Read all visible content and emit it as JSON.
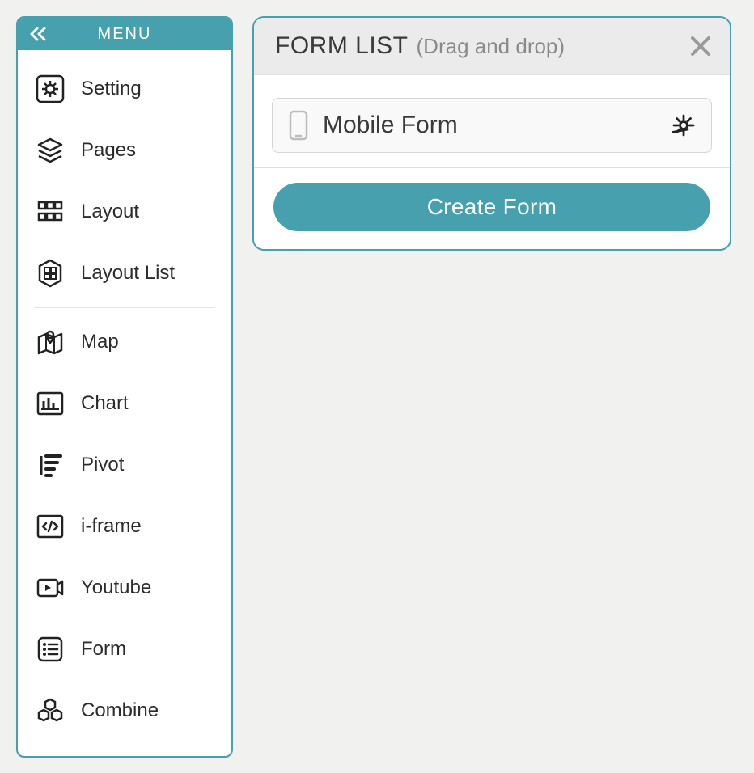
{
  "colors": {
    "accent": "#46a0ad"
  },
  "sidebar": {
    "title": "MENU",
    "items": [
      {
        "label": "Setting",
        "icon": "gear-icon"
      },
      {
        "label": "Pages",
        "icon": "layers-icon"
      },
      {
        "label": "Layout",
        "icon": "grid-icon"
      },
      {
        "label": "Layout List",
        "icon": "layout-list-icon"
      },
      {
        "label": "Map",
        "icon": "map-icon"
      },
      {
        "label": "Chart",
        "icon": "chart-icon"
      },
      {
        "label": "Pivot",
        "icon": "pivot-icon"
      },
      {
        "label": "i-frame",
        "icon": "code-icon"
      },
      {
        "label": "Youtube",
        "icon": "video-icon"
      },
      {
        "label": "Form",
        "icon": "form-icon"
      },
      {
        "label": "Combine",
        "icon": "combine-icon"
      }
    ]
  },
  "panel": {
    "title": "FORM LIST",
    "subtitle": "(Drag and drop)",
    "forms": [
      {
        "name": "Mobile Form",
        "device": "mobile"
      }
    ],
    "create_label": "Create Form"
  }
}
